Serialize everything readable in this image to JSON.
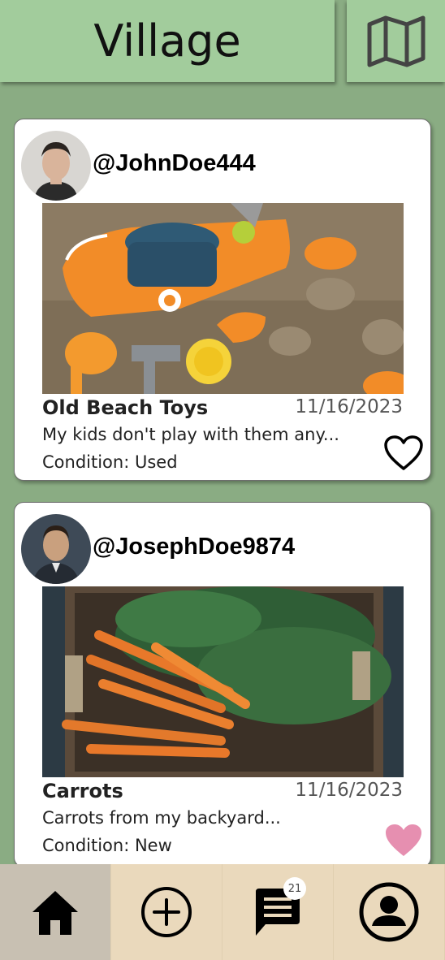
{
  "header": {
    "title": "Village",
    "map_icon": "map-icon"
  },
  "posts": [
    {
      "username": "@JohnDoe444",
      "title": "Old Beach Toys",
      "date": "11/16/2023",
      "description": "My kids don't play with them any...",
      "condition": "Condition: Used",
      "liked": false
    },
    {
      "username": "@JosephDoe9874",
      "title": "Carrots",
      "date": "11/16/2023",
      "description": "Carrots from my backyard...",
      "condition": "Condition: New",
      "liked": true
    }
  ],
  "nav": {
    "items": [
      {
        "icon": "home-icon",
        "active": true
      },
      {
        "icon": "add-circle-icon",
        "active": false
      },
      {
        "icon": "message-icon",
        "active": false,
        "badge": "21"
      },
      {
        "icon": "profile-icon",
        "active": false
      }
    ]
  },
  "colors": {
    "background": "#8aac83",
    "header": "#a2cc9c",
    "nav": "#ead9bc",
    "nav_active": "#c8c0b2",
    "heart_liked": "#e68fb0"
  }
}
